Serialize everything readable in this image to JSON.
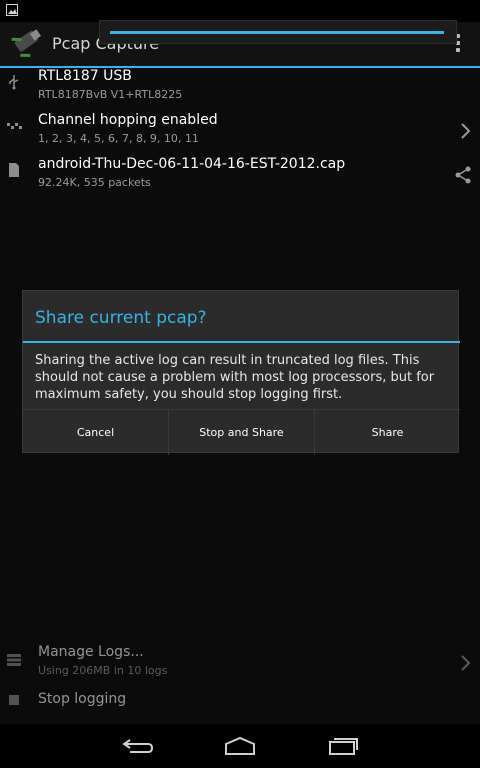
{
  "app": {
    "title": "Pcap Capture"
  },
  "progress": {
    "value": 1.0,
    "accent": "#33b5e5"
  },
  "list": {
    "items": [
      {
        "title": "RTL8187 USB",
        "subtitle": "RTL8187BvB V1+RTL8225",
        "icon": "usb-icon"
      },
      {
        "title": "Channel hopping enabled",
        "subtitle": "1, 2, 3, 4, 5, 6, 7, 8, 9, 10, 11",
        "icon": "channel-hopping-icon",
        "action": "chevron-right-icon"
      },
      {
        "title": "android-Thu-Dec-06-11-04-16-EST-2012.cap",
        "subtitle": "92.24K, 535 packets",
        "icon": "sd-card-icon",
        "action": "share-icon"
      }
    ],
    "bottom": [
      {
        "title": "Manage Logs...",
        "subtitle": "Using 206MB in 10 logs",
        "icon": "storage-icon",
        "action": "chevron-right-icon"
      },
      {
        "title": "Stop logging",
        "icon": "stop-icon"
      }
    ]
  },
  "dialog": {
    "title": "Share current pcap?",
    "message": "Sharing the active log can result in truncated log files.  This should not cause a problem with most log processors, but for maximum safety, you should stop logging first.",
    "buttons": {
      "cancel": "Cancel",
      "stop_share": "Stop and Share",
      "share": "Share"
    }
  },
  "colors": {
    "accent": "#33b5e5",
    "background": "#0b0b0b",
    "dialog": "#2b2b2b"
  }
}
